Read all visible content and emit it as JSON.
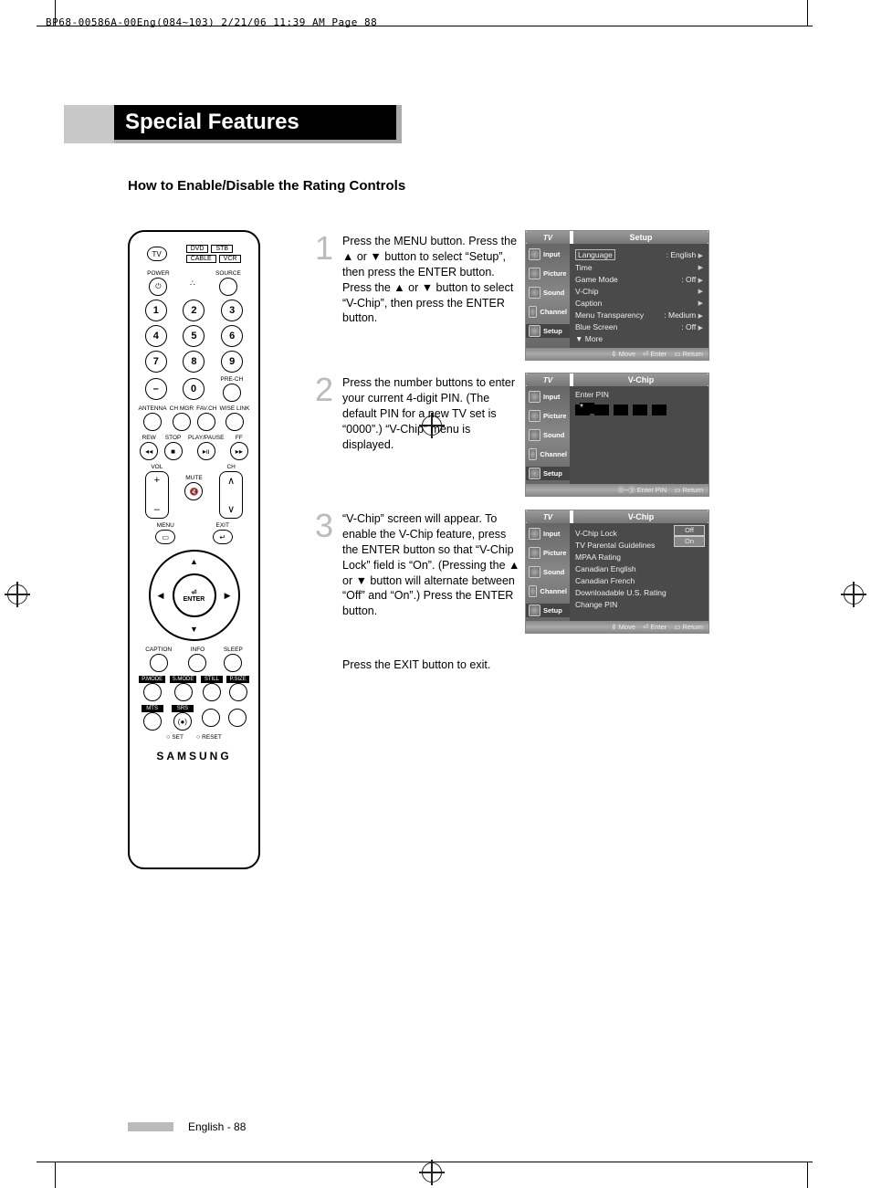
{
  "header_slug": "BP68-00586A-00Eng(084~103)  2/21/06  11:39 AM  Page 88",
  "feature_title": "Special Features",
  "subhead": "How to Enable/Disable the Rating Controls",
  "footer": "English - 88",
  "steps": {
    "s1": {
      "num": "1",
      "text": "Press the MENU button. Press the ▲ or ▼ button to select “Setup”, then press the ENTER button. Press the ▲ or ▼ button to select “V-Chip”, then press the ENTER button."
    },
    "s2": {
      "num": "2",
      "text": "Press the number buttons to enter your current 4-digit PIN. (The default PIN for a new TV set is “0000”.) “V-Chip” menu is displayed."
    },
    "s3": {
      "num": "3",
      "text": "“V-Chip” screen will appear. To enable the V-Chip feature, press the ENTER button so that “V-Chip Lock” field is “On”. (Pressing the ▲ or ▼ button will alternate between “Off” and “On”.) Press the ENTER button."
    },
    "exit": "Press the EXIT button to exit."
  },
  "remote": {
    "mode_tv": "TV",
    "mode_dvd": "DVD",
    "mode_stb": "STB",
    "mode_cable": "CABLE",
    "mode_vcr": "VCR",
    "power": "POWER",
    "source": "SOURCE",
    "prech": "PRE-CH",
    "ant": "ANTENNA",
    "chmgr": "CH MGR",
    "favch": "FAV.CH",
    "wiselink": "WISE LINK",
    "rew": "REW",
    "stop": "STOP",
    "playpause": "PLAY/PAUSE",
    "ff": "FF",
    "vol": "VOL",
    "ch": "CH",
    "mute": "MUTE",
    "menu": "MENU",
    "exit": "EXIT",
    "enter": "ENTER",
    "caption": "CAPTION",
    "info": "INFO",
    "sleep": "SLEEP",
    "pmode": "P.MODE",
    "smode": "S.MODE",
    "still": "STILL",
    "psize": "P.SIZE",
    "mts": "MTS",
    "srs": "SRS",
    "set": "SET",
    "reset": "RESET",
    "brand": "SAMSUNG"
  },
  "osd_common": {
    "tv": "TV",
    "side_input": "Input",
    "side_picture": "Picture",
    "side_sound": "Sound",
    "side_channel": "Channel",
    "side_setup": "Setup",
    "foot_move": "Move",
    "foot_enter": "Enter",
    "foot_return": "Return",
    "foot_enterpin": "Enter PIN"
  },
  "osd1": {
    "title": "Setup",
    "lines": [
      {
        "label": "Language",
        "value": ": English"
      },
      {
        "label": "Time",
        "value": ""
      },
      {
        "label": "Game Mode",
        "value": ": Off"
      },
      {
        "label": "V-Chip",
        "value": ""
      },
      {
        "label": "Caption",
        "value": ""
      },
      {
        "label": "Menu Transparency",
        "value": ": Medium"
      },
      {
        "label": "Blue Screen",
        "value": ": Off"
      },
      {
        "label": "▼ More",
        "value": ""
      }
    ]
  },
  "osd2": {
    "title": "V-Chip",
    "prompt": "Enter PIN"
  },
  "osd3": {
    "title": "V-Chip",
    "lines": [
      "V-Chip Lock",
      "TV Parental Guidelines",
      "MPAA Rating",
      "Canadian English",
      "Canadian French",
      "Downloadable U.S. Rating",
      "Change PIN"
    ],
    "opt_off": "Off",
    "opt_on": "On"
  }
}
